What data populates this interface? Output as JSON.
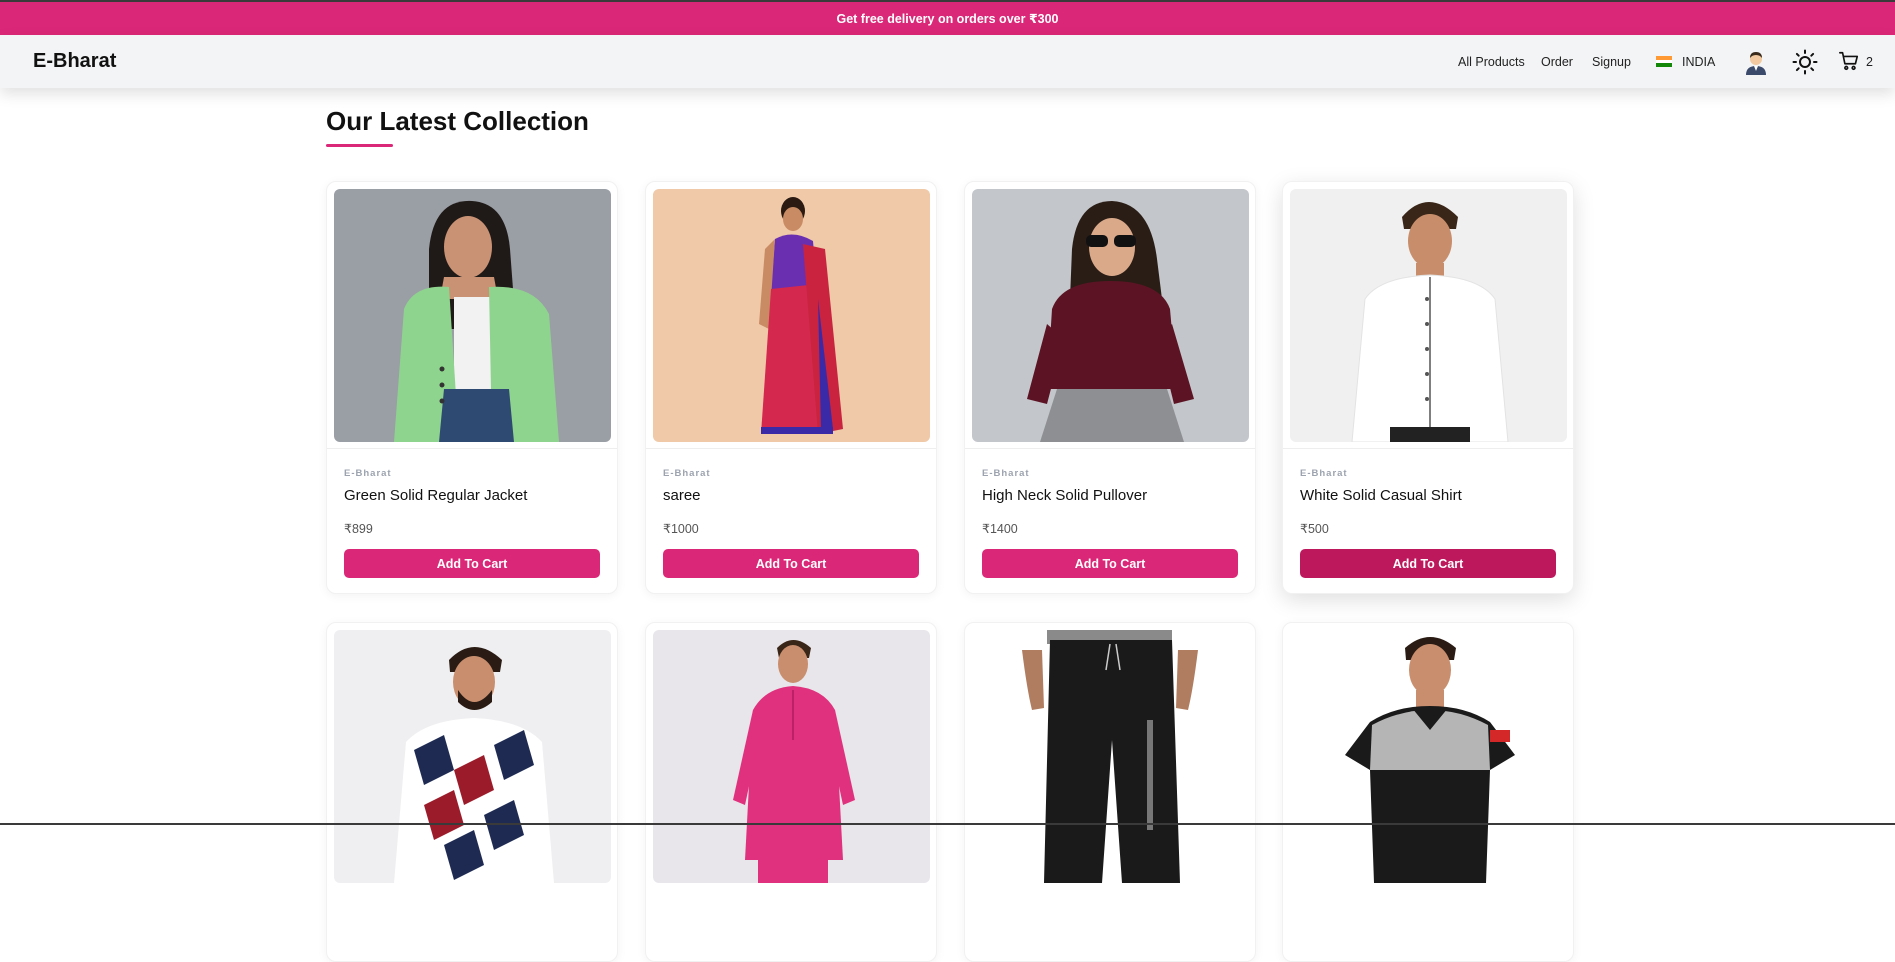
{
  "promo": {
    "text": "Get free delivery on orders over ₹300"
  },
  "navbar": {
    "logo": "E-Bharat",
    "links": [
      {
        "label": "All Products"
      },
      {
        "label": "Order"
      },
      {
        "label": "Signup"
      }
    ],
    "country": "INDIA",
    "cart_count": "2",
    "icons": [
      "india-flag-icon",
      "user-avatar-icon",
      "sun-icon",
      "cart-icon"
    ]
  },
  "section": {
    "title": "Our Latest Collection"
  },
  "products": [
    {
      "brand": "E-Bharat",
      "name": "Green Solid Regular Jacket",
      "price": "₹899",
      "button": "Add To Cart"
    },
    {
      "brand": "E-Bharat",
      "name": "saree",
      "price": "₹1000",
      "button": "Add To Cart"
    },
    {
      "brand": "E-Bharat",
      "name": "High Neck Solid Pullover",
      "price": "₹1400",
      "button": "Add To Cart"
    },
    {
      "brand": "E-Bharat",
      "name": "White Solid Casual Shirt",
      "price": "₹500",
      "button": "Add To Cart"
    }
  ],
  "colors": {
    "accent": "#db2777",
    "accent_hover": "#be185d",
    "navbar_bg": "#f3f4f6"
  }
}
